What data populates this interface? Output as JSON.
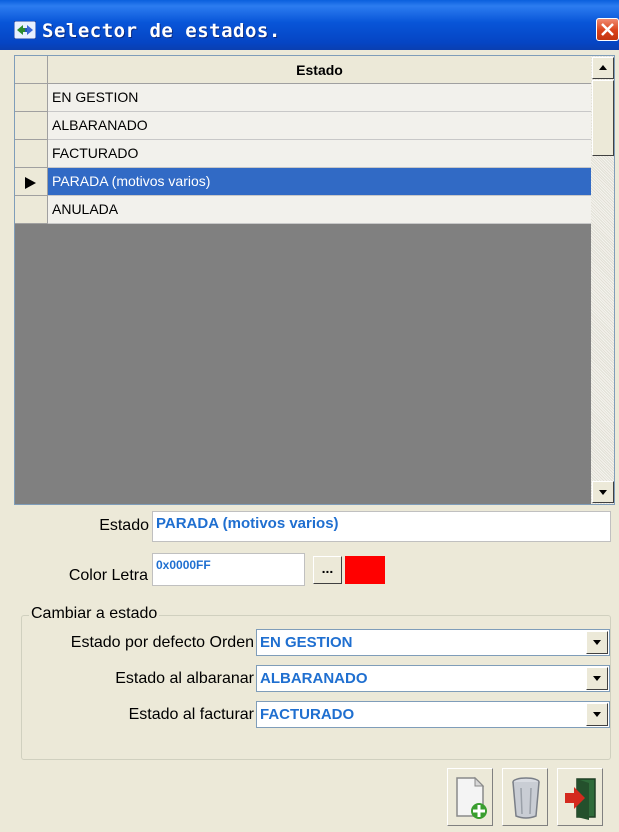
{
  "window": {
    "title": "Selector de estados.",
    "title_icon": "arrows-icon",
    "close_icon": "close-icon"
  },
  "grid": {
    "column_header": "Estado",
    "rows": [
      {
        "label": "EN GESTION",
        "selected": false
      },
      {
        "label": "ALBARANADO",
        "selected": false
      },
      {
        "label": "FACTURADO",
        "selected": false
      },
      {
        "label": "PARADA (motivos varios)",
        "selected": true
      },
      {
        "label": "ANULADA",
        "selected": false
      }
    ],
    "selected_color": "#316AC5"
  },
  "form": {
    "estado_label": "Estado",
    "estado_value": "PARADA (motivos varios)",
    "color_letra_label": "Color Letra",
    "color_letra_value": "0x0000FF",
    "picker_button": "...",
    "swatch_color": "#FF0000",
    "value_color": "#1F6FD0"
  },
  "cambiar": {
    "group_title": "Cambiar a estado",
    "defecto_label": "Estado por defecto Orden",
    "defecto_value": "EN GESTION",
    "albaranar_label": "Estado al albaranar",
    "albaranar_value": "ALBARANADO",
    "facturar_label": "Estado al facturar",
    "facturar_value": "FACTURADO"
  },
  "toolbar": {
    "new_icon": "new-document-icon",
    "delete_icon": "trash-icon",
    "exit_icon": "exit-door-icon"
  }
}
